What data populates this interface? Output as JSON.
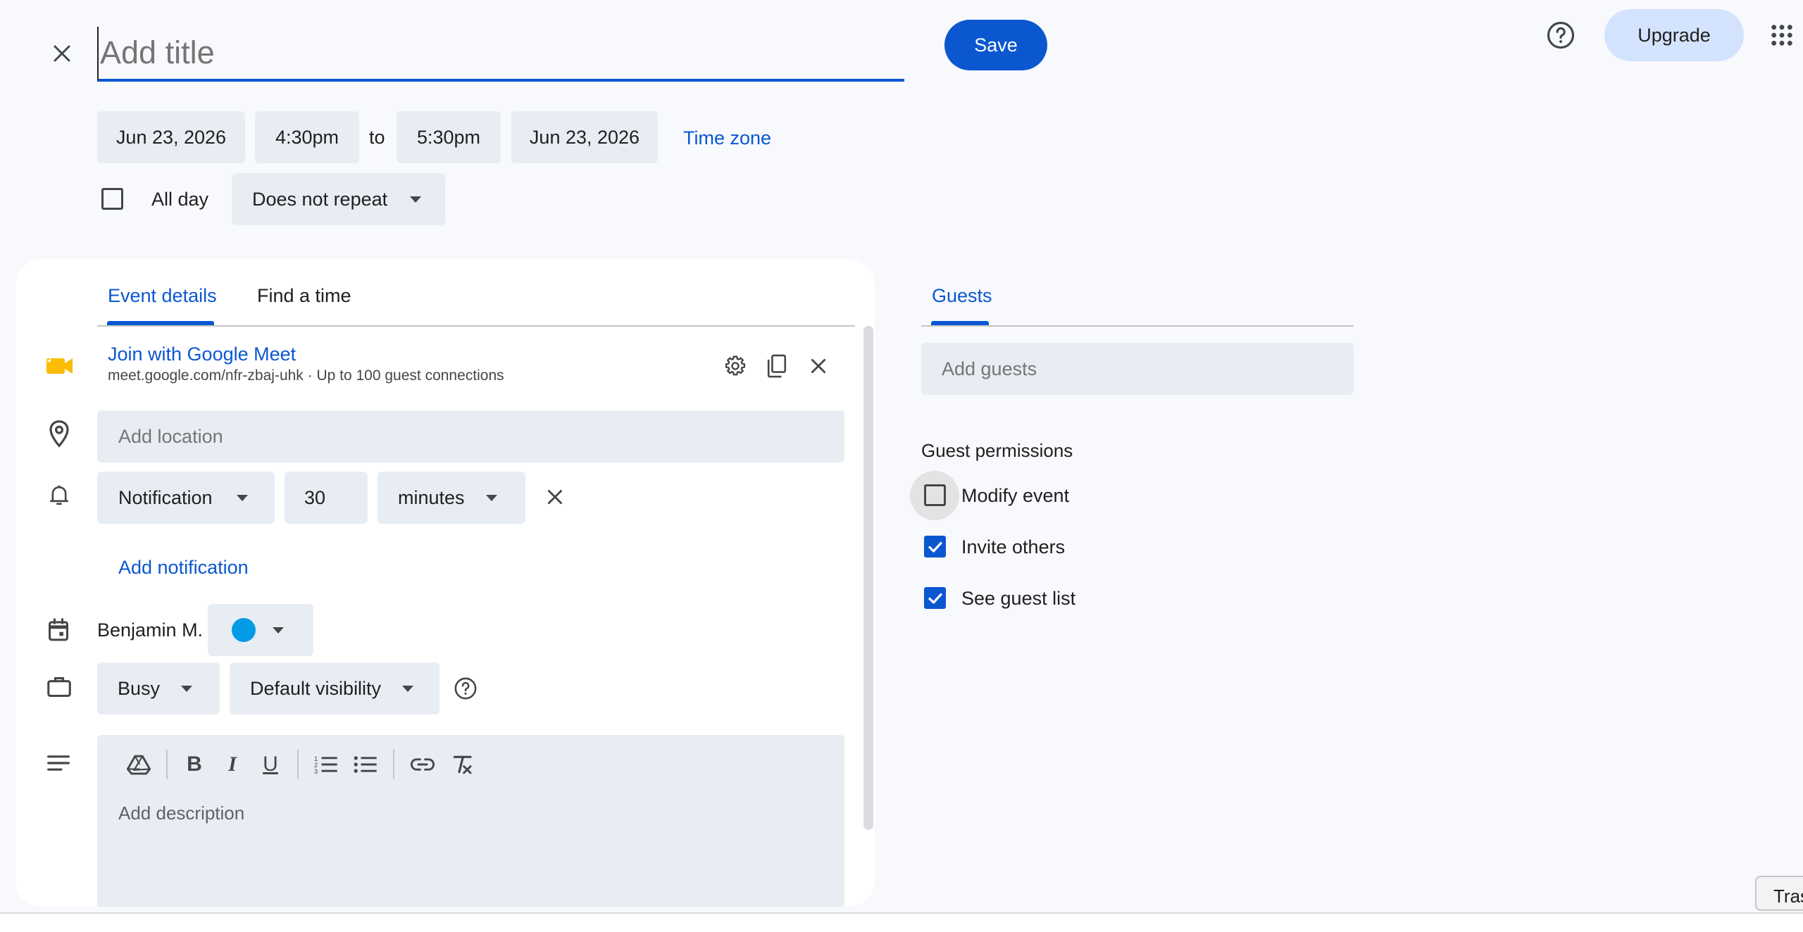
{
  "header": {
    "title_placeholder": "Add title",
    "save_label": "Save",
    "upgrade_label": "Upgrade"
  },
  "datetime": {
    "start_date": "Jun 23, 2026",
    "start_time": "4:30pm",
    "to_label": "to",
    "end_time": "5:30pm",
    "end_date": "Jun 23, 2026",
    "timezone_label": "Time zone",
    "allday_label": "All day",
    "allday_checked": false,
    "repeat_label": "Does not repeat"
  },
  "tabs": {
    "event_details": "Event details",
    "find_time": "Find a time",
    "guests": "Guests"
  },
  "meet": {
    "title": "Join with Google Meet",
    "subtitle": "meet.google.com/nfr-zbaj-uhk · Up to 100 guest connections"
  },
  "location": {
    "placeholder": "Add location"
  },
  "notification": {
    "type": "Notification",
    "value": "30",
    "unit": "minutes",
    "add_label": "Add notification"
  },
  "calendar": {
    "owner": "Benjamin M.",
    "color": "#039be5"
  },
  "availability": {
    "status": "Busy",
    "visibility": "Default visibility"
  },
  "description": {
    "placeholder": "Add description"
  },
  "guests": {
    "placeholder": "Add guests",
    "permissions_title": "Guest permissions",
    "permissions": [
      {
        "label": "Modify event",
        "checked": false
      },
      {
        "label": "Invite others",
        "checked": true
      },
      {
        "label": "See guest list",
        "checked": true
      }
    ]
  },
  "bottom_chip": {
    "label": "Tras"
  },
  "colors": {
    "accent": "#0b57d0",
    "background": "#f7f9fd",
    "field": "#e8edf4",
    "meet_icon": "#fbbc04"
  }
}
